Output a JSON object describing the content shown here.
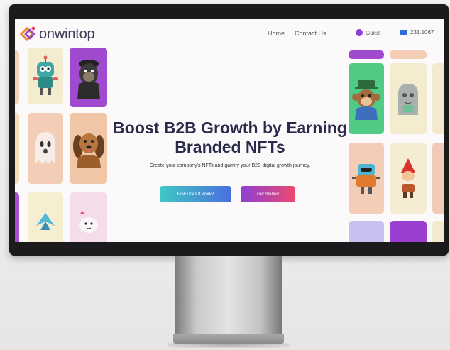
{
  "brand": {
    "name": "onwintop"
  },
  "nav": {
    "links": [
      "Home",
      "Contact Us"
    ],
    "user_label": "Guest",
    "wallet_label": "231.1067"
  },
  "hero": {
    "title": "Boost B2B Growth by Earning Branded NFTs",
    "subtitle": "Create your company's NFTs and gamify your B2B digital growth journey.",
    "btn_how": "How Does It Work?",
    "btn_start": "Get Started"
  },
  "colors": {
    "title": "#2a2b4a",
    "btn_how_gradient": [
      "#3fc9c2",
      "#4a6ee0"
    ],
    "btn_start_gradient": [
      "#8e3fd6",
      "#ea4a6c"
    ],
    "logo_orange": "#f08a2b",
    "logo_purple": "#8a3fd1"
  },
  "cards": [
    {
      "name": "robot-nft-card",
      "icon": "robot-icon"
    },
    {
      "name": "gorilla-nft-card",
      "icon": "gorilla-icon"
    },
    {
      "name": "ghost-nft-card",
      "icon": "ghost-icon"
    },
    {
      "name": "dog-nft-card",
      "icon": "dog-icon"
    },
    {
      "name": "bird-nft-card",
      "icon": "bird-icon"
    },
    {
      "name": "cloud-nft-card",
      "icon": "cloud-icon"
    },
    {
      "name": "monkey-nft-card",
      "icon": "monkey-icon"
    },
    {
      "name": "tombstone-nft-card",
      "icon": "tombstone-icon"
    },
    {
      "name": "robot-orange-nft-card",
      "icon": "robot-icon"
    },
    {
      "name": "gnome-nft-card",
      "icon": "gnome-icon"
    }
  ]
}
